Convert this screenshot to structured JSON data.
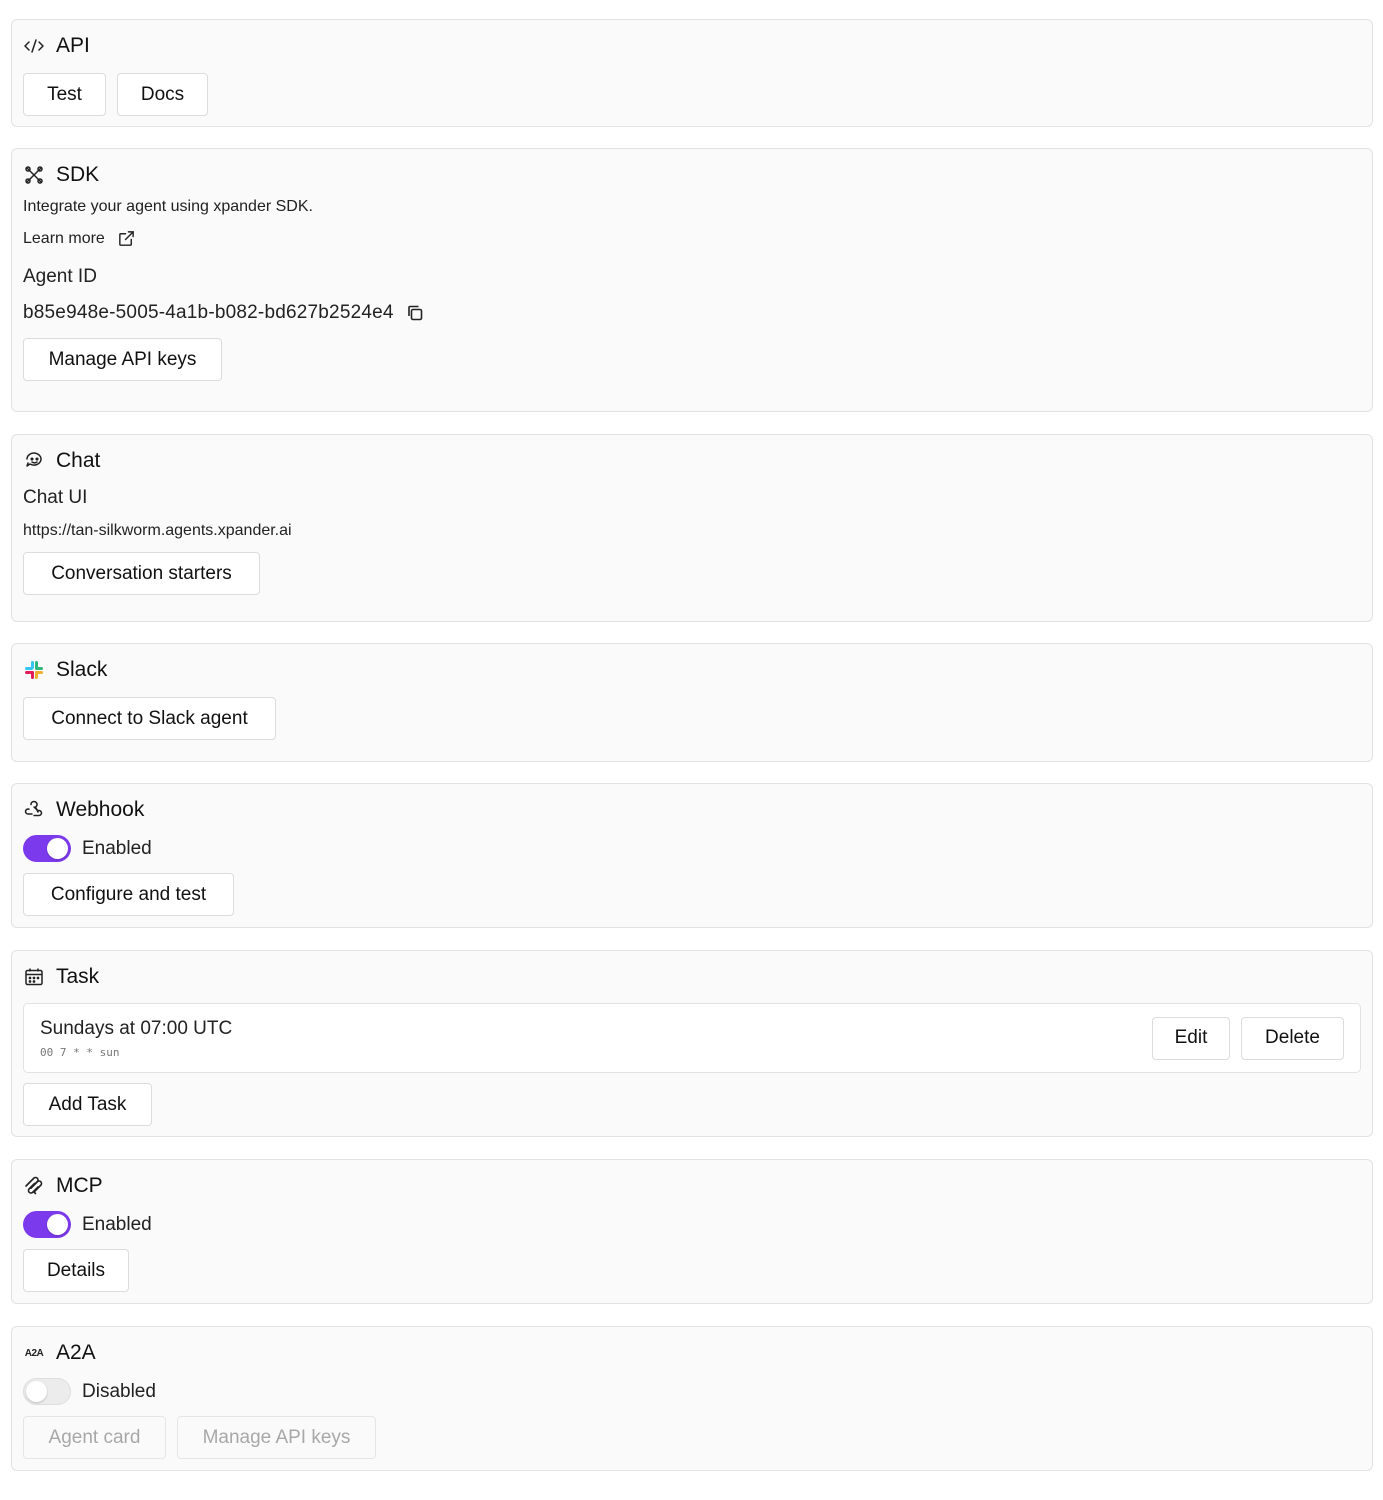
{
  "api": {
    "title": "API",
    "icon": "code-icon",
    "buttons": {
      "test": "Test",
      "docs": "Docs"
    }
  },
  "sdk": {
    "title": "SDK",
    "icon": "sdk-icon",
    "description": "Integrate your agent using xpander SDK.",
    "learn_more": "Learn more",
    "agent_id_label": "Agent ID",
    "agent_id": "b85e948e-5005-4a1b-b082-bd627b2524e4",
    "manage_keys": "Manage API keys"
  },
  "chat": {
    "title": "Chat",
    "icon": "chat-bot-icon",
    "ui_label": "Chat UI",
    "url": "https://tan-silkworm.agents.xpander.ai",
    "starters": "Conversation starters"
  },
  "slack": {
    "title": "Slack",
    "icon": "slack-icon",
    "connect": "Connect to Slack agent"
  },
  "webhook": {
    "title": "Webhook",
    "icon": "webhook-icon",
    "status": "Enabled",
    "enabled": true,
    "configure": "Configure and test"
  },
  "task": {
    "title": "Task",
    "icon": "calendar-icon",
    "items": [
      {
        "schedule": "Sundays at 07:00 UTC",
        "cron": "00 7 * * sun",
        "edit": "Edit",
        "delete": "Delete"
      }
    ],
    "add": "Add Task"
  },
  "mcp": {
    "title": "MCP",
    "icon": "mcp-icon",
    "status": "Enabled",
    "enabled": true,
    "details": "Details"
  },
  "a2a": {
    "title": "A2A",
    "icon": "a2a-icon",
    "icon_text": "A2A",
    "status": "Disabled",
    "enabled": false,
    "agent_card": "Agent card",
    "manage_keys": "Manage API keys"
  },
  "colors": {
    "accent": "#7c3aed",
    "card_bg": "#fafafa",
    "border": "#e2e2e2"
  }
}
